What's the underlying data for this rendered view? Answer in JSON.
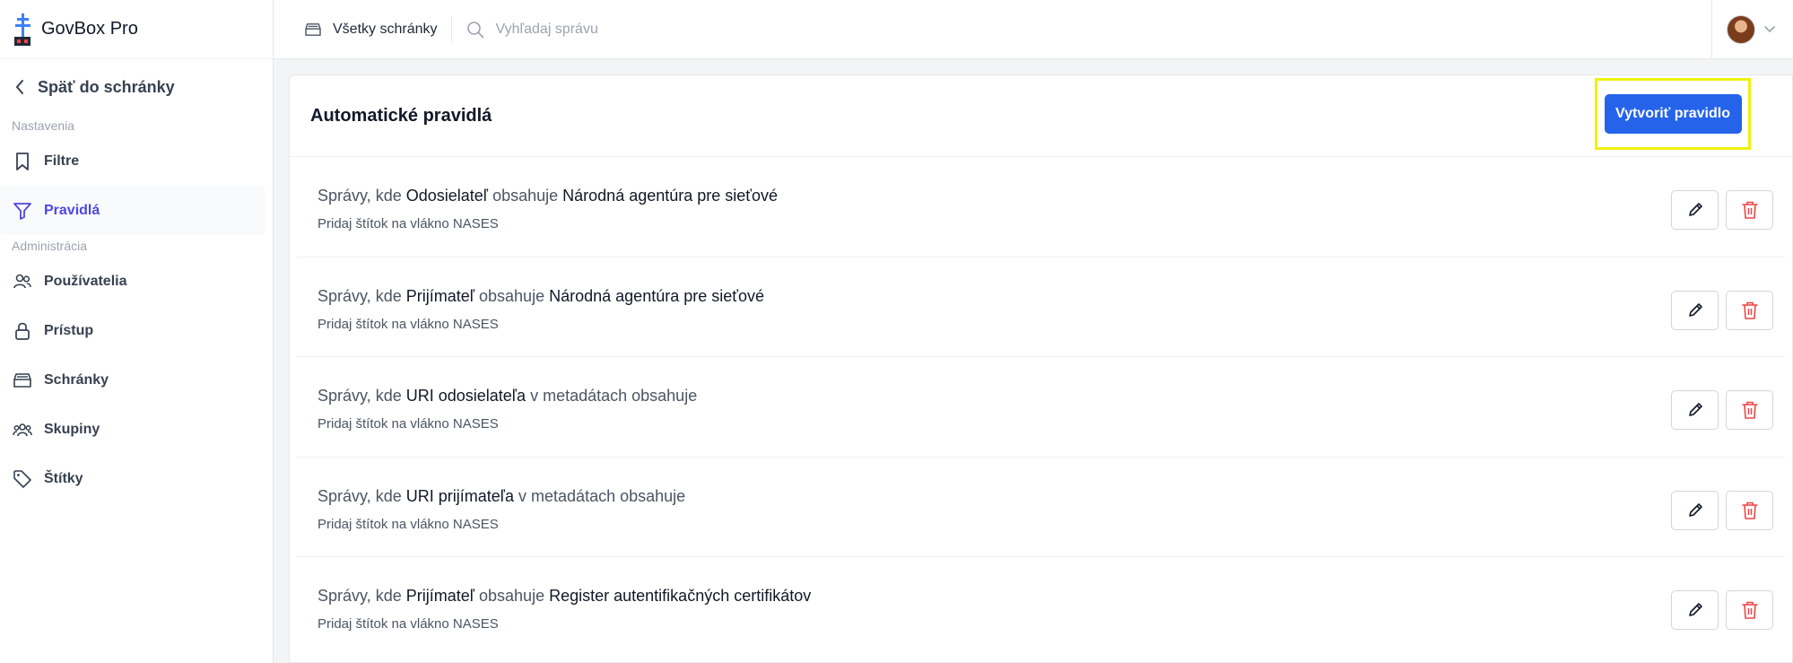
{
  "app": {
    "name": "GovBox Pro"
  },
  "sidebar": {
    "back_label": "Späť do schránky",
    "section_settings": "Nastavenia",
    "section_admin": "Administrácia",
    "items": [
      {
        "label": "Filtre",
        "icon": "bookmark-icon"
      },
      {
        "label": "Pravidlá",
        "icon": "filter-icon",
        "active": true
      },
      {
        "label": "Používatelia",
        "icon": "users-icon"
      },
      {
        "label": "Prístup",
        "icon": "lock-icon"
      },
      {
        "label": "Schránky",
        "icon": "inbox-icon"
      },
      {
        "label": "Skupiny",
        "icon": "group-icon"
      },
      {
        "label": "Štítky",
        "icon": "tag-icon"
      }
    ]
  },
  "topbar": {
    "mailbox_label": "Všetky schránky",
    "search_placeholder": "Vyhľadaj správu"
  },
  "main": {
    "title": "Automatické pravidlá",
    "create_button": "Vytvoriť pravidlo",
    "rules": [
      {
        "prefix": "Správy, kde",
        "field": "Odosielateľ",
        "op": "obsahuje",
        "value": "Národná agentúra pre sieťové",
        "action_prefix": "Pridaj štítok na vlákno",
        "tag": "NASES"
      },
      {
        "prefix": "Správy, kde",
        "field": "Prijímateľ",
        "op": "obsahuje",
        "value": "Národná agentúra pre sieťové",
        "action_prefix": "Pridaj štítok na vlákno",
        "tag": "NASES"
      },
      {
        "prefix": "Správy, kde",
        "field": "URI odosielateľa",
        "op": "v metadátach obsahuje",
        "value": "",
        "action_prefix": "Pridaj štítok na vlákno",
        "tag": "NASES"
      },
      {
        "prefix": "Správy, kde",
        "field": "URI prijímateľa",
        "op": "v metadátach obsahuje",
        "value": "",
        "action_prefix": "Pridaj štítok na vlákno",
        "tag": "NASES"
      },
      {
        "prefix": "Správy, kde",
        "field": "Prijímateľ",
        "op": "obsahuje",
        "value": "Register autentifikačných certifikátov",
        "action_prefix": "Pridaj štítok na vlákno",
        "tag": "NASES"
      }
    ]
  },
  "colors": {
    "primary": "#2563eb",
    "active_nav": "#4f46e5",
    "delete": "#ef4444",
    "highlight": "#eef20a"
  }
}
